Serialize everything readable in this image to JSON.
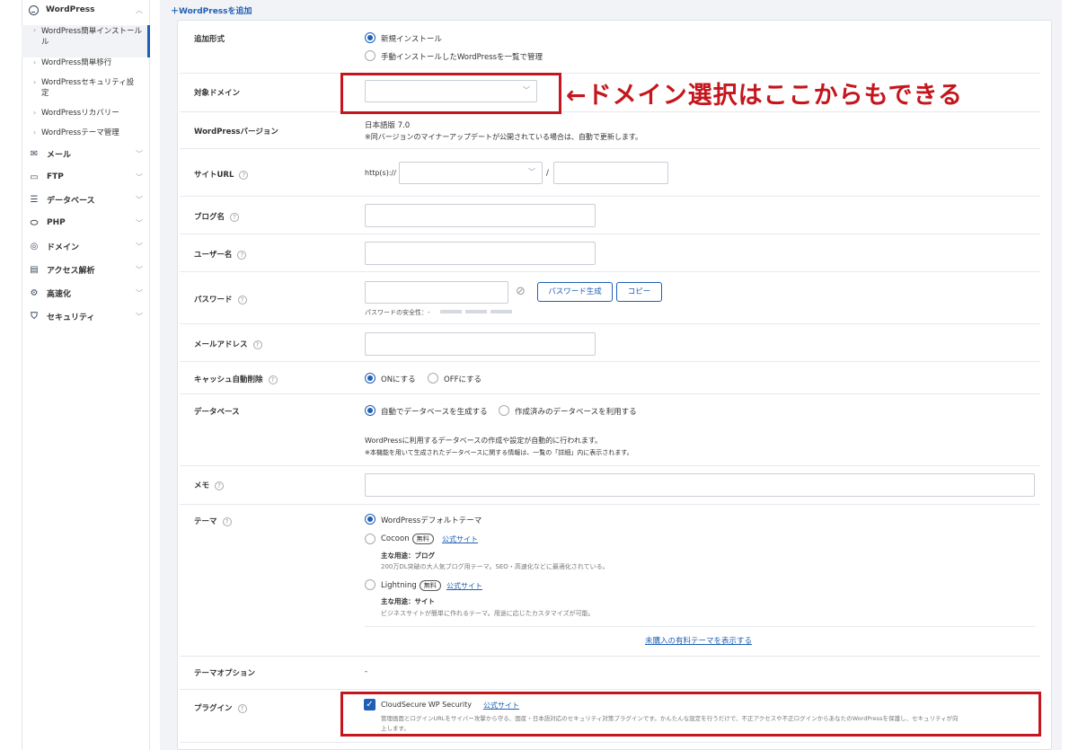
{
  "sidebar": {
    "header": "WordPress",
    "sub_items": [
      {
        "label": "WordPress簡単インストール",
        "label2": "ル"
      },
      {
        "label": "WordPress簡単移行"
      },
      {
        "label": "WordPressセキュリティ設",
        "label2": "定"
      },
      {
        "label": "WordPressリカバリー"
      },
      {
        "label": "WordPressテーマ管理"
      }
    ],
    "menus": [
      {
        "label": "メール",
        "icon": "mail-icon"
      },
      {
        "label": "FTP",
        "icon": "monitor-icon"
      },
      {
        "label": "データベース",
        "icon": "database-icon"
      },
      {
        "label": "PHP",
        "icon": "php-icon"
      },
      {
        "label": "ドメイン",
        "icon": "globe-icon"
      },
      {
        "label": "アクセス解析",
        "icon": "chart-icon"
      },
      {
        "label": "高速化",
        "icon": "speed-icon"
      },
      {
        "label": "セキュリティ",
        "icon": "shield-icon"
      }
    ]
  },
  "main": {
    "add_link": "＋WordPressを追加",
    "add_type": {
      "label": "追加形式",
      "opt1": "新規インストール",
      "opt2": "手動インストールしたWordPressを一覧で管理"
    },
    "domain": {
      "label": "対象ドメイン"
    },
    "annotation": "←ドメイン選択はここからもできる",
    "version": {
      "label": "WordPressバージョン",
      "value": "日本語版 7.0",
      "note": "※同バージョンのマイナーアップデートが公開されている場合は、自動で更新します。"
    },
    "site_url": {
      "label": "サイトURL",
      "prefix": "http(s)://",
      "slash": "/"
    },
    "blog_name": {
      "label": "ブログ名"
    },
    "user_name": {
      "label": "ユーザー名"
    },
    "password": {
      "label": "パスワード",
      "gen_button": "パスワード生成",
      "copy_button": "コピー",
      "strength": "パスワードの安全性：-"
    },
    "email": {
      "label": "メールアドレス"
    },
    "cache": {
      "label": "キャッシュ自動削除",
      "on": "ONにする",
      "off": "OFFにする"
    },
    "database": {
      "label": "データベース",
      "opt1": "自動でデータベースを生成する",
      "opt2": "作成済みのデータベースを利用する",
      "note1": "WordPressに利用するデータベースの作成や設定が自動的に行われます。",
      "note2": "※本機能を用いて生成されたデータベースに関する情報は、一覧の「詳細」内に表示されます。"
    },
    "memo": {
      "label": "メモ"
    },
    "theme": {
      "label": "テーマ",
      "default": "WordPressデフォルトテーマ",
      "cocoon": "Cocoon",
      "cocoon_badge": "無料",
      "cocoon_link": "公式サイト",
      "cocoon_use": "主な用途：ブログ",
      "cocoon_desc": "200万DL突破の大人気ブログ用テーマ。SEO・高速化などに最適化されている。",
      "lightning": "Lightning",
      "lightning_badge": "無料",
      "lightning_link": "公式サイト",
      "lightning_use": "主な用途：サイト",
      "lightning_desc": "ビジネスサイトが簡単に作れるテーマ。用途に応じたカスタマイズが可能。",
      "paid_link": "未購入の有料テーマを表示する"
    },
    "theme_option": {
      "label": "テーマオプション",
      "value": "-"
    },
    "plugin": {
      "label": "プラグイン",
      "name": "CloudSecure WP Security",
      "link": "公式サイト",
      "desc1": "管理画面とログインURLをサイバー攻撃から守る、国産・日本語対応のセキュリティ対策プラグインです。かんたんな設定を行うだけで、不正アクセスや不正ログインからあなたのWordPressを保護し、セキュリティが向",
      "desc2": "上します。"
    }
  },
  "colors": {
    "accent": "#1f5fb5",
    "annotation": "#c4161c",
    "background": "#f1f3f6"
  }
}
